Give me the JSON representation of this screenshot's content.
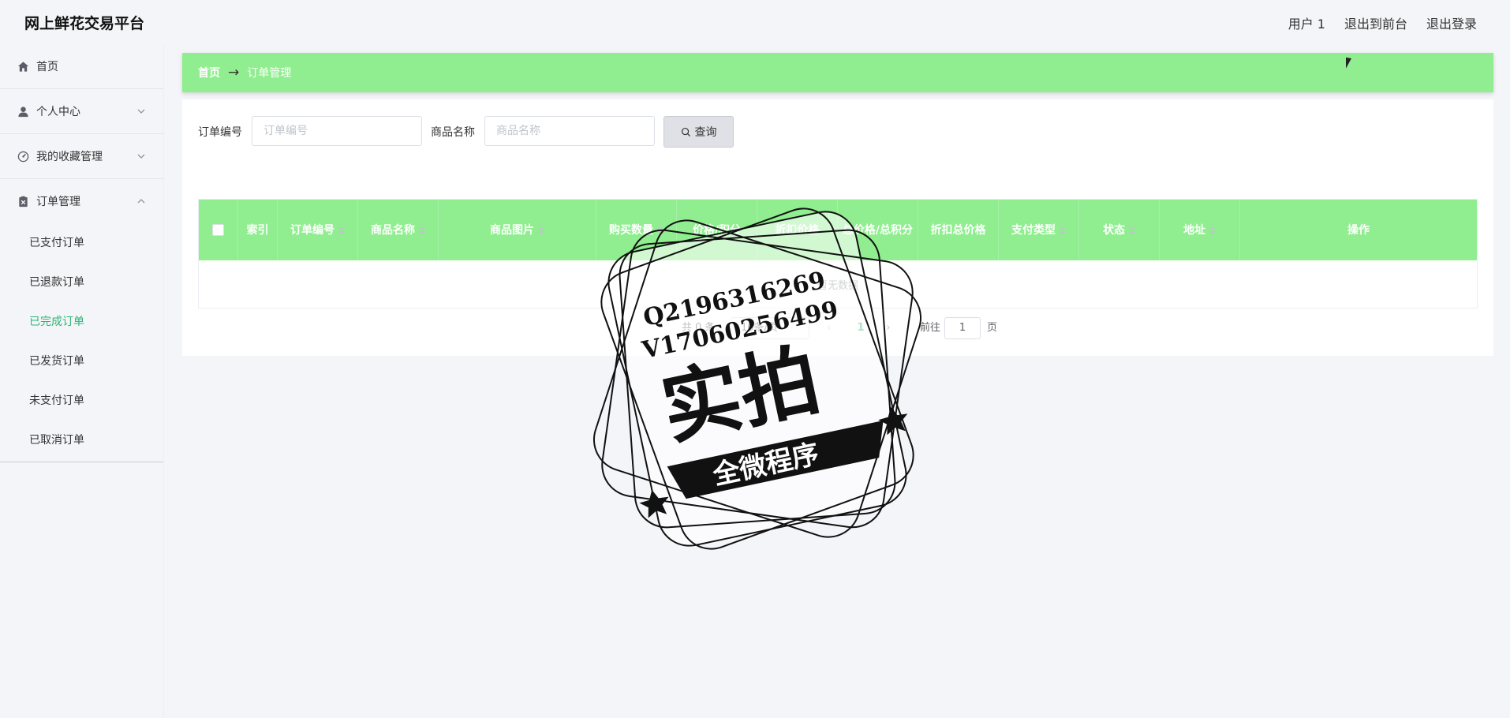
{
  "header": {
    "brand": "网上鲜花交易平台",
    "links": [
      "用户 1",
      "退出到前台",
      "退出登录"
    ]
  },
  "sidebar": {
    "items": [
      {
        "label": "首页",
        "icon": "home-icon"
      },
      {
        "label": "个人中心",
        "icon": "user-icon"
      },
      {
        "label": "我的收藏管理",
        "icon": "dashboard-icon"
      },
      {
        "label": "订单管理",
        "icon": "order-icon"
      }
    ],
    "submenu": [
      {
        "label": "已支付订单"
      },
      {
        "label": "已退款订单"
      },
      {
        "label": "已完成订单",
        "active": true
      },
      {
        "label": "已发货订单"
      },
      {
        "label": "未支付订单"
      },
      {
        "label": "已取消订单"
      }
    ]
  },
  "breadcrumb": {
    "home": "首页",
    "separator": "→",
    "current": "订单管理"
  },
  "search": {
    "order_no_label": "订单编号",
    "order_no_placeholder": "订单编号",
    "product_label": "商品名称",
    "product_placeholder": "商品名称",
    "button": "查询"
  },
  "table": {
    "columns": [
      "索引",
      "订单编号",
      "商品名称",
      "商品图片",
      "购买数量",
      "价格/积分",
      "折扣价格",
      "总价格/总积分",
      "折扣总价格",
      "支付类型",
      "状态",
      "地址",
      "操作"
    ],
    "empty_text": "暂无数据"
  },
  "pagination": {
    "total": "共 0 条",
    "page_size": "10条/页",
    "current_page": "1",
    "goto_label": "前往",
    "goto_value": "1",
    "page_suffix": "页"
  },
  "watermark": {
    "line1": "Q2196316269",
    "line2": "V17060256499",
    "main": "实拍",
    "banner": "全微程序"
  },
  "colors": {
    "accent_green": "#90ee90",
    "active_text": "#2bb673",
    "background": "#f4f5f9"
  }
}
